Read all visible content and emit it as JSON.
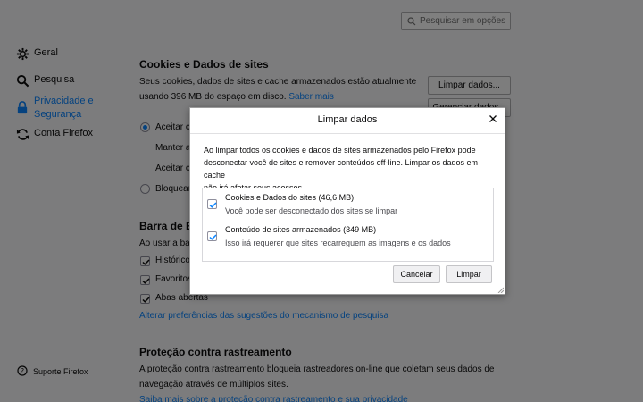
{
  "search": {
    "placeholder": "Pesquisar em opções"
  },
  "sidebar": {
    "items": [
      {
        "label": "Geral",
        "icon": "gear-icon"
      },
      {
        "label": "Pesquisa",
        "icon": "search-icon"
      },
      {
        "label": "Privacidade e Segurança",
        "line1": "Privacidade e",
        "line2": "Segurança",
        "icon": "lock-icon",
        "active": true
      },
      {
        "label": "Conta Firefox",
        "icon": "sync-icon"
      }
    ],
    "support": "Suporte Firefox"
  },
  "cookies": {
    "title": "Cookies e Dados de sites",
    "desc_line1": "Seus cookies, dados de sites e cache armazenados estão atualmente",
    "desc_line2": "usando 396 MB do espaço em disco.",
    "learn_more": "Saber mais",
    "clear_button": "Limpar dados...",
    "manage_button": "Gerenciar dados...",
    "radio1": "Aceitar c",
    "keep": "Manter a",
    "accept": "Aceitar c",
    "block": "Bloquear"
  },
  "address_bar": {
    "title": "Barra de En",
    "intro": "Ao usar a bar",
    "options": [
      "Histórico",
      "Favoritos",
      "Abas abertas"
    ],
    "link": "Alterar preferências das sugestões do mecanismo de pesquisa"
  },
  "tracking": {
    "title": "Proteção contra rastreamento",
    "line1": "A proteção contra rastreamento bloqueia rastreadores on-line que coletam seus dados de",
    "line2": "navegação através de múltiplos sites.",
    "link": "Saiba mais sobre a proteção contra rastreamento e sua privacidade"
  },
  "dialog": {
    "title": "Limpar dados",
    "desc_line1": "Ao limpar todos os cookies e dados de sites armazenados pelo Firefox pode",
    "desc_line2": "desconectar você de sites e remover conteúdos off-line. Limpar os dados em cache",
    "desc_line3": "não irá afetar seus acessos.",
    "options": [
      {
        "title": "Cookies e Dados do sites (46,6 MB)",
        "subtitle": "Você pode ser desconectado dos sites se limpar",
        "checked": true
      },
      {
        "title": "Conteúdo de sites armazenados (349 MB)",
        "subtitle": "Isso irá requerer que sites recarreguem as imagens e os dados",
        "checked": true
      }
    ],
    "cancel": "Cancelar",
    "clear": "Limpar"
  },
  "colors": {
    "accent": "#0a84ff",
    "overlay": "rgba(0,0,0,0.5)"
  }
}
